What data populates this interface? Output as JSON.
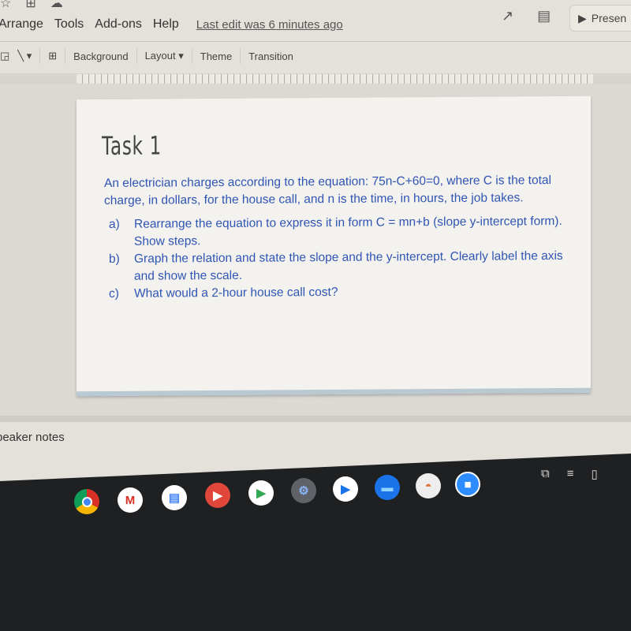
{
  "menu": {
    "items": [
      "Arrange",
      "Tools",
      "Add-ons",
      "Help"
    ],
    "last_edit": "Last edit was 6 minutes ago"
  },
  "header": {
    "present_label": "Presen"
  },
  "toolbar": {
    "background": "Background",
    "layout": "Layout",
    "theme": "Theme",
    "transition": "Transition"
  },
  "slide": {
    "title": "Task 1",
    "intro": "An electrician charges according to  the equation:  75n-C+60=0, where C is the total charge, in dollars, for the house call, and n is the time, in hours, the job takes.",
    "items": [
      {
        "marker": "a)",
        "text": "Rearrange the equation to express it in form C = mn+b (slope y-intercept form). Show steps."
      },
      {
        "marker": "b)",
        "text": "Graph the relation and state the slope and the y-intercept. Clearly label the axis and show the scale."
      },
      {
        "marker": "c)",
        "text": "What would a 2-hour house call cost?"
      }
    ]
  },
  "notes": {
    "label": "peaker notes"
  },
  "shelf": {
    "apps": [
      "chrome",
      "gmail",
      "docs",
      "youtube",
      "play-store",
      "settings",
      "play-movies",
      "files",
      "drawing",
      "zoom"
    ]
  },
  "colors": {
    "slide_text": "#2f55b4",
    "shelf": "#1f2022"
  }
}
